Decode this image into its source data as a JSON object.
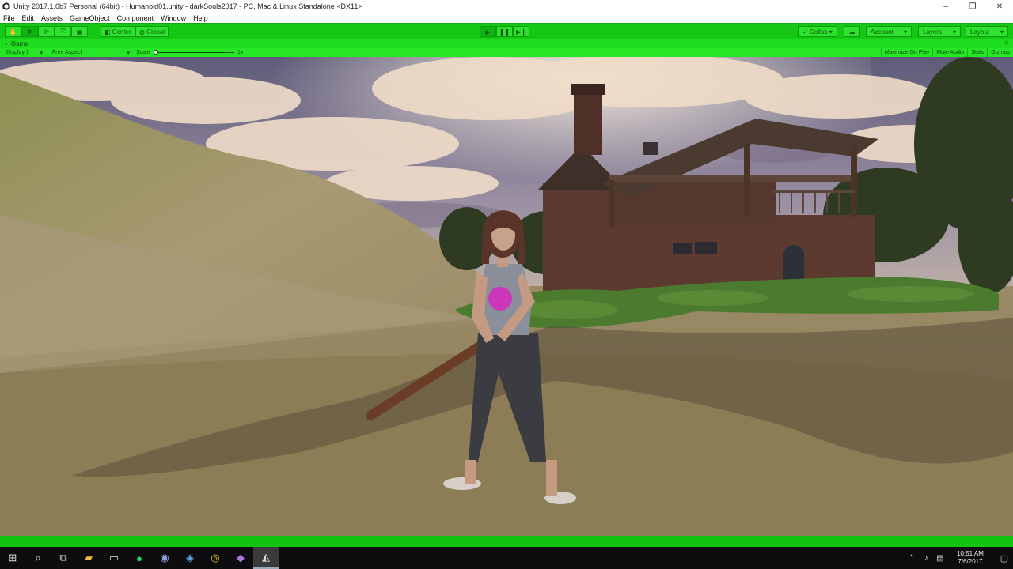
{
  "window": {
    "title": "Unity 2017.1.0b7 Personal (64bit) - Humanoid01.unity - darkSouls2017 - PC, Mac & Linux Standalone <DX11>",
    "minimize": "–",
    "maximize": "❐",
    "close": "✕"
  },
  "menu": [
    "File",
    "Edit",
    "Assets",
    "GameObject",
    "Component",
    "Window",
    "Help"
  ],
  "toolbar": {
    "tools": [
      "hand-tool",
      "move-tool",
      "rotate-tool",
      "scale-tool",
      "rect-tool"
    ],
    "active_tool": "move-tool",
    "pivot_label": "Center",
    "space_label": "Global",
    "collab_label": "Collab",
    "account_label": "Account",
    "layers_label": "Layers",
    "layout_label": "Layout"
  },
  "game_tab": {
    "label": "Game",
    "display": "Display 1",
    "aspect": "Free Aspect",
    "scale_label": "Scale",
    "scale_value": "1x",
    "options": [
      "Maximize On Play",
      "Mute Audio",
      "Stats",
      "Gizmos"
    ]
  },
  "taskbar": {
    "time": "10:51 AM",
    "date": "7/6/2017"
  },
  "colors": {
    "toolbar_green": "#16c716",
    "sky_top": "#6d6a86",
    "ground": "#8d7a55"
  }
}
